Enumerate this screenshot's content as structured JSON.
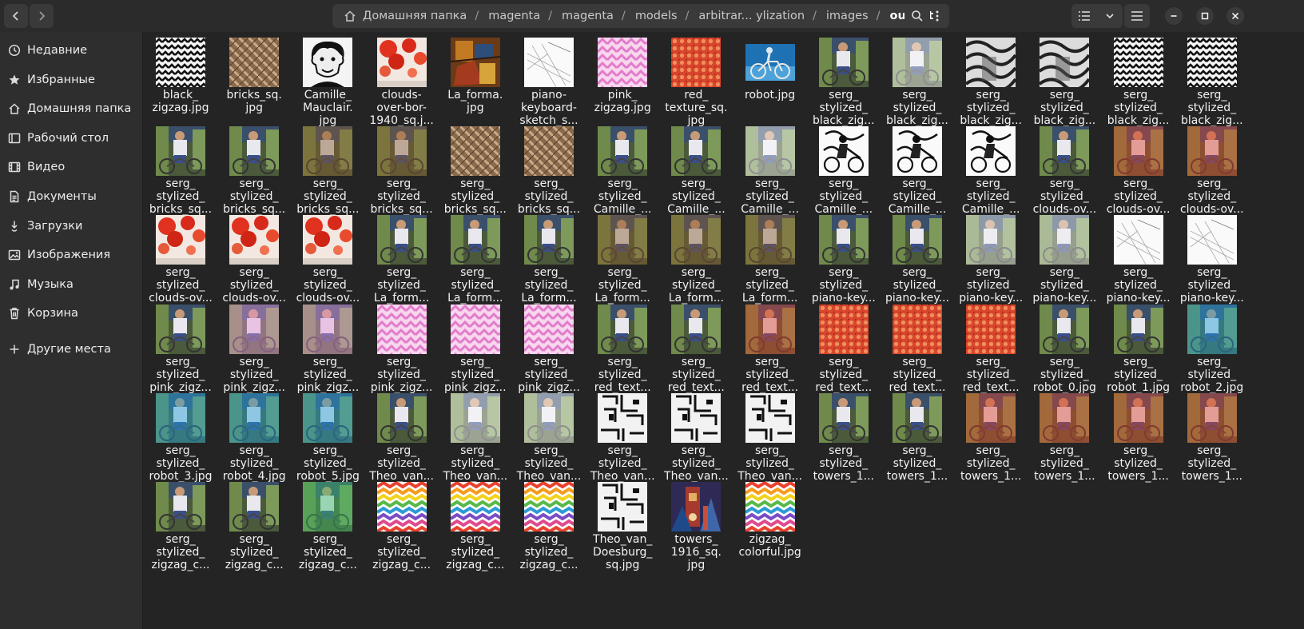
{
  "window": {
    "path": [
      "Домашняя папка",
      "magenta",
      "magenta",
      "models",
      "arbitrar... ylization",
      "images",
      "output"
    ]
  },
  "sidebar": {
    "items": [
      {
        "label": "Недавние",
        "icon": "clock-icon"
      },
      {
        "label": "Избранные",
        "icon": "star-icon"
      },
      {
        "label": "Домашняя папка",
        "icon": "home-icon"
      },
      {
        "label": "Рабочий стол",
        "icon": "desktop-icon"
      },
      {
        "label": "Видео",
        "icon": "video-icon"
      },
      {
        "label": "Документы",
        "icon": "document-icon"
      },
      {
        "label": "Загрузки",
        "icon": "download-icon"
      },
      {
        "label": "Изображения",
        "icon": "image-icon"
      },
      {
        "label": "Музыка",
        "icon": "music-icon"
      },
      {
        "label": "Корзина",
        "icon": "trash-icon"
      }
    ],
    "other_places": {
      "label": "Другие места",
      "icon": "plus-icon"
    }
  },
  "files": [
    {
      "name": "black_\nzigzag.jpg",
      "thumb": "bw-zigzag"
    },
    {
      "name": "bricks_sq.\njpg",
      "thumb": "bricks"
    },
    {
      "name": "Camille_\nMauclair.\njpg",
      "thumb": "portrait"
    },
    {
      "name": "clouds-\nover-bor-\n1940_sq.j...",
      "thumb": "clouds"
    },
    {
      "name": "La_forma.\njpg",
      "thumb": "laforma"
    },
    {
      "name": "piano-\nkeyboard-\nsketch_s...",
      "thumb": "sketch"
    },
    {
      "name": "pink_\nzigzag.jpg",
      "thumb": "pink-zigzag"
    },
    {
      "name": "red_\ntexture_sq.\njpg",
      "thumb": "red-texture"
    },
    {
      "name": "robot.jpg",
      "thumb": "robot"
    },
    {
      "name": "serg_\nstylized_\nblack_zig...",
      "thumb": "photo"
    },
    {
      "name": "serg_\nstylized_\nblack_zig...",
      "thumb": "photo-bw"
    },
    {
      "name": "serg_\nstylized_\nblack_zig...",
      "thumb": "bw-swirl"
    },
    {
      "name": "serg_\nstylized_\nblack_zig...",
      "thumb": "bw-swirl"
    },
    {
      "name": "serg_\nstylized_\nblack_zig...",
      "thumb": "bw-zigzag"
    },
    {
      "name": "serg_\nstylized_\nblack_zig...",
      "thumb": "bw-zigzag"
    },
    {
      "name": "serg_\nstylized_\nbricks_sq...",
      "thumb": "photo"
    },
    {
      "name": "serg_\nstylized_\nbricks_sq...",
      "thumb": "photo"
    },
    {
      "name": "serg_\nstylized_\nbricks_sq...",
      "thumb": "photo-brown"
    },
    {
      "name": "serg_\nstylized_\nbricks_sq...",
      "thumb": "photo-brown"
    },
    {
      "name": "serg_\nstylized_\nbricks_sq...",
      "thumb": "bricks"
    },
    {
      "name": "serg_\nstylized_\nbricks_sq...",
      "thumb": "bricks"
    },
    {
      "name": "serg_\nstylized_\nCamille_...",
      "thumb": "photo"
    },
    {
      "name": "serg_\nstylized_\nCamille_...",
      "thumb": "photo"
    },
    {
      "name": "serg_\nstylized_\nCamille_...",
      "thumb": "photo-ink"
    },
    {
      "name": "serg_\nstylized_\nCamille_...",
      "thumb": "ink"
    },
    {
      "name": "serg_\nstylized_\nCamille_...",
      "thumb": "ink"
    },
    {
      "name": "serg_\nstylized_\nCamille_...",
      "thumb": "ink"
    },
    {
      "name": "serg_\nstylized_\nclouds-ov...",
      "thumb": "photo"
    },
    {
      "name": "serg_\nstylized_\nclouds-ov...",
      "thumb": "photo-red"
    },
    {
      "name": "serg_\nstylized_\nclouds-ov...",
      "thumb": "photo-red"
    },
    {
      "name": "serg_\nstylized_\nclouds-ov...",
      "thumb": "clouds"
    },
    {
      "name": "serg_\nstylized_\nclouds-ov...",
      "thumb": "clouds"
    },
    {
      "name": "serg_\nstylized_\nclouds-ov...",
      "thumb": "clouds"
    },
    {
      "name": "serg_\nstylized_\nLa_form...",
      "thumb": "photo"
    },
    {
      "name": "serg_\nstylized_\nLa_form...",
      "thumb": "photo"
    },
    {
      "name": "serg_\nstylized_\nLa_form...",
      "thumb": "photo"
    },
    {
      "name": "serg_\nstylized_\nLa_form...",
      "thumb": "photo-brown"
    },
    {
      "name": "serg_\nstylized_\nLa_form...",
      "thumb": "photo-brown"
    },
    {
      "name": "serg_\nstylized_\nLa_form...",
      "thumb": "photo-brown"
    },
    {
      "name": "serg_\nstylized_\npiano-key...",
      "thumb": "photo"
    },
    {
      "name": "serg_\nstylized_\npiano-key...",
      "thumb": "photo"
    },
    {
      "name": "serg_\nstylized_\npiano-key...",
      "thumb": "photo-light"
    },
    {
      "name": "serg_\nstylized_\npiano-key...",
      "thumb": "photo-light"
    },
    {
      "name": "serg_\nstylized_\npiano-key...",
      "thumb": "sketch"
    },
    {
      "name": "serg_\nstylized_\npiano-key...",
      "thumb": "sketch"
    },
    {
      "name": "serg_\nstylized_\npink_zigz...",
      "thumb": "photo"
    },
    {
      "name": "serg_\nstylized_\npink_zigz...",
      "thumb": "photo-pink"
    },
    {
      "name": "serg_\nstylized_\npink_zigz...",
      "thumb": "photo-pink"
    },
    {
      "name": "serg_\nstylized_\npink_zigz...",
      "thumb": "pink-zigzag"
    },
    {
      "name": "serg_\nstylized_\npink_zigz...",
      "thumb": "pink-zigzag"
    },
    {
      "name": "serg_\nstylized_\npink_zigz...",
      "thumb": "pink-zigzag"
    },
    {
      "name": "serg_\nstylized_\nred_text...",
      "thumb": "photo"
    },
    {
      "name": "serg_\nstylized_\nred_text...",
      "thumb": "photo"
    },
    {
      "name": "serg_\nstylized_\nred_text...",
      "thumb": "photo-red"
    },
    {
      "name": "serg_\nstylized_\nred_text...",
      "thumb": "red-texture"
    },
    {
      "name": "serg_\nstylized_\nred_text...",
      "thumb": "red-texture"
    },
    {
      "name": "serg_\nstylized_\nred_text...",
      "thumb": "red-texture"
    },
    {
      "name": "serg_\nstylized_\nrobot_0.jpg",
      "thumb": "photo"
    },
    {
      "name": "serg_\nstylized_\nrobot_1.jpg",
      "thumb": "photo"
    },
    {
      "name": "serg_\nstylized_\nrobot_2.jpg",
      "thumb": "photo-blue"
    },
    {
      "name": "serg_\nstylized_\nrobot_3.jpg",
      "thumb": "photo-blue"
    },
    {
      "name": "serg_\nstylized_\nrobot_4.jpg",
      "thumb": "photo-blue"
    },
    {
      "name": "serg_\nstylized_\nrobot_5.jpg",
      "thumb": "photo-blue"
    },
    {
      "name": "serg_\nstylized_\nTheo_van...",
      "thumb": "photo"
    },
    {
      "name": "serg_\nstylized_\nTheo_van...",
      "thumb": "photo-bw"
    },
    {
      "name": "serg_\nstylized_\nTheo_van...",
      "thumb": "photo-bw"
    },
    {
      "name": "serg_\nstylized_\nTheo_van...",
      "thumb": "theo"
    },
    {
      "name": "serg_\nstylized_\nTheo_van...",
      "thumb": "theo"
    },
    {
      "name": "serg_\nstylized_\nTheo_van...",
      "thumb": "theo"
    },
    {
      "name": "serg_\nstylized_\ntowers_1...",
      "thumb": "photo"
    },
    {
      "name": "serg_\nstylized_\ntowers_1...",
      "thumb": "photo"
    },
    {
      "name": "serg_\nstylized_\ntowers_1...",
      "thumb": "photo-red"
    },
    {
      "name": "serg_\nstylized_\ntowers_1...",
      "thumb": "photo-red"
    },
    {
      "name": "serg_\nstylized_\ntowers_1...",
      "thumb": "photo-red"
    },
    {
      "name": "serg_\nstylized_\ntowers_1...",
      "thumb": "photo-red"
    },
    {
      "name": "serg_\nstylized_\nzigzag_c...",
      "thumb": "photo"
    },
    {
      "name": "serg_\nstylized_\nzigzag_c...",
      "thumb": "photo"
    },
    {
      "name": "serg_\nstylized_\nzigzag_c...",
      "thumb": "photo-green"
    },
    {
      "name": "serg_\nstylized_\nzigzag_c...",
      "thumb": "color-zigzag"
    },
    {
      "name": "serg_\nstylized_\nzigzag_c...",
      "thumb": "color-zigzag"
    },
    {
      "name": "serg_\nstylized_\nzigzag_c...",
      "thumb": "color-zigzag"
    },
    {
      "name": "Theo_van_\nDoesburg_\nsq.jpg",
      "thumb": "theo"
    },
    {
      "name": "towers_\n1916_sq.\njpg",
      "thumb": "towers"
    },
    {
      "name": "zigzag_\ncolorful.jpg",
      "thumb": "color-zigzag"
    }
  ]
}
